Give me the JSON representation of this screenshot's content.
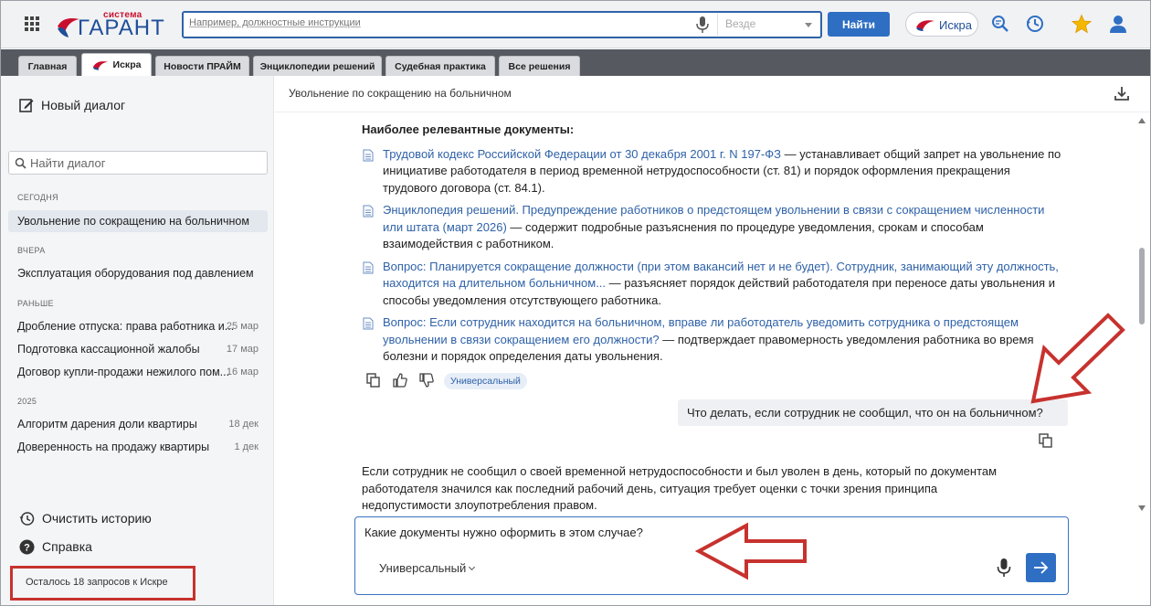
{
  "header": {
    "logo_small": "система",
    "logo_main": "ГАРАНТ",
    "search_placeholder": "Например, должностные инструкции",
    "search_scope": "Везде",
    "find_label": "Найти",
    "iskra_label": "Искра"
  },
  "tabs": [
    {
      "label": "Главная",
      "active": false
    },
    {
      "label": "Искра",
      "active": true
    },
    {
      "label": "Новости ПРАЙМ",
      "active": false
    },
    {
      "label": "Энциклопедии решений",
      "active": false
    },
    {
      "label": "Судебная практика",
      "active": false
    },
    {
      "label": "Все решения",
      "active": false
    }
  ],
  "sidebar": {
    "new_dialog": "Новый диалог",
    "find_placeholder": "Найти диалог",
    "sections": {
      "today": "СЕГОДНЯ",
      "yesterday": "ВЧЕРА",
      "earlier": "РАНЬШЕ",
      "year": "2025"
    },
    "today_items": [
      {
        "title": "Увольнение по сокращению на больничном",
        "date": ""
      }
    ],
    "yesterday_items": [
      {
        "title": "Эксплуатация оборудования под давлением",
        "date": ""
      }
    ],
    "earlier_items": [
      {
        "title": "Дробление отпуска: права работника и...",
        "date": "25 мар"
      },
      {
        "title": "Подготовка кассационной жалобы",
        "date": "17 мар"
      },
      {
        "title": "Договор купли-продажи нежилого пом...",
        "date": "16 мар"
      }
    ],
    "year_items": [
      {
        "title": "Алгоритм дарения доли квартиры",
        "date": "18 дек"
      },
      {
        "title": "Доверенность на продажу квартиры",
        "date": "1 дек"
      }
    ],
    "clear_history": "Очистить историю",
    "help": "Справка",
    "quota": "Осталось 18 запросов к Искре"
  },
  "main": {
    "title": "Увольнение по сокращению на больничном",
    "relevant_heading": "Наиболее релевантные документы:",
    "documents": [
      {
        "link": "Трудовой кодекс Российской Федерации от 30 декабря 2001 г. N 197-ФЗ",
        "desc": " — устанавливает общий запрет на увольнение по инициативе работодателя в период временной нетрудоспособности (ст. 81) и порядок оформления прекращения трудового договора (ст. 84.1)."
      },
      {
        "link": "Энциклопедия решений. Предупреждение работников о предстоящем увольнении в связи с сокращением численности или штата (март 2026)",
        "desc": " — содержит подробные разъяснения по процедуре уведомления, срокам и способам взаимодействия с работником."
      },
      {
        "link": "Вопрос: Планируется сокращение должности (при этом вакансий нет и не будет). Сотрудник, занимающий эту должность, находится на длительном больничном...",
        "desc": " — разъясняет порядок действий работодателя при переносе даты увольнения и способы уведомления отсутствующего работника."
      },
      {
        "link": "Вопрос: Если сотрудник находится на больничном, вправе ли работодатель уведомить сотрудника о предстоящем увольнении в связи сокращением его должности?",
        "desc": " — подтверждает правомерность уведомления работника во время болезни и порядок определения даты увольнения."
      }
    ],
    "mode_tag": "Универсальный",
    "user_message": "Что делать, если сотрудник не сообщил, что он на больничном?",
    "answer": "Если сотрудник не сообщил о своей временной нетрудоспособности и был уволен в день, который по документам работодателя значился как последний рабочий день, ситуация требует оценки с точки зрения принципа недопустимости злоупотребления правом.",
    "composer_text": "Какие документы нужно оформить в этом случае?",
    "composer_mode": "Универсальный"
  },
  "colors": {
    "accent": "#2f6fc3",
    "link": "#2f62a8",
    "annotation": "#c7322e"
  }
}
